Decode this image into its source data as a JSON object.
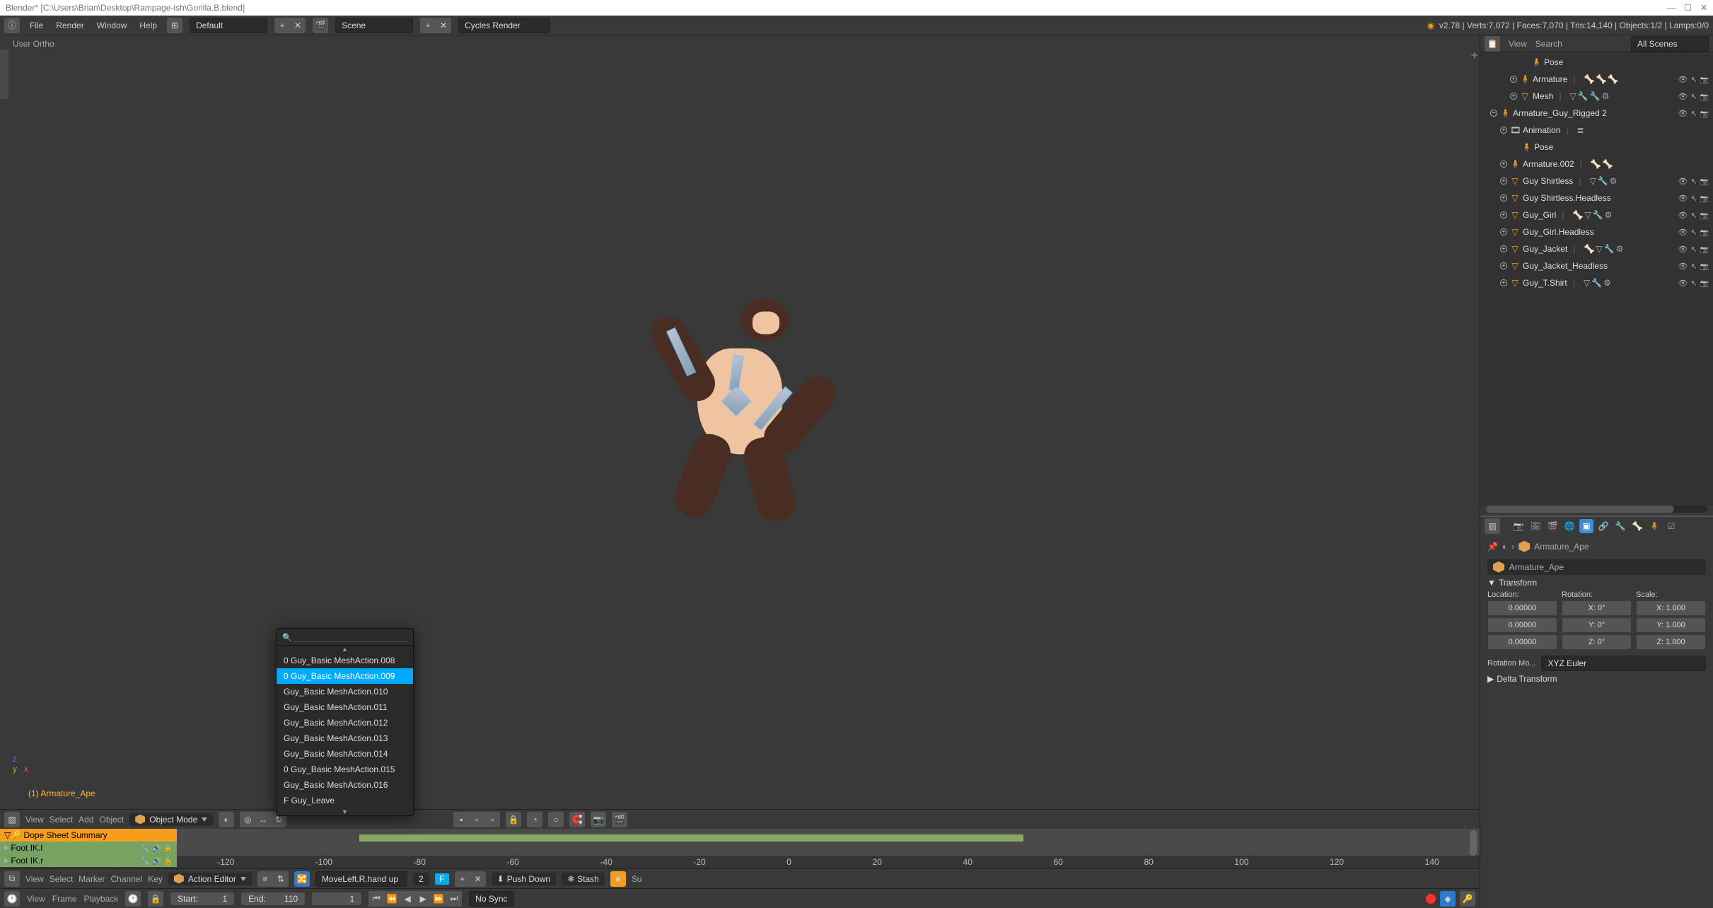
{
  "titlebar": {
    "title": "Blender* [C:\\Users\\Brian\\Desktop\\Rampage-ish\\Gorilla.B.blend]"
  },
  "top_menu": {
    "file": "File",
    "render": "Render",
    "window": "Window",
    "help": "Help",
    "layout_field": "Default",
    "scene_field": "Scene",
    "engine": "Cycles Render",
    "stats": "v2.78 | Verts:7,072 | Faces:7,070 | Tris:14,140 | Objects:1/2 | Lamps:0/0"
  },
  "view3d": {
    "overlay": "User Ortho",
    "selected": "(1) Armature_Ape",
    "axes": {
      "x": "x",
      "y": "y",
      "z": "z"
    }
  },
  "view3d_header": {
    "view": "View",
    "select": "Select",
    "add": "Add",
    "object": "Object",
    "mode": "Object Mode"
  },
  "action_popup": {
    "items": [
      {
        "label": "0 Guy_Basic MeshAction.008",
        "selected": false
      },
      {
        "label": "0 Guy_Basic MeshAction.009",
        "selected": true
      },
      {
        "label": "Guy_Basic MeshAction.010",
        "selected": false
      },
      {
        "label": "Guy_Basic MeshAction.011",
        "selected": false
      },
      {
        "label": "Guy_Basic MeshAction.012",
        "selected": false
      },
      {
        "label": "Guy_Basic MeshAction.013",
        "selected": false
      },
      {
        "label": "Guy_Basic MeshAction.014",
        "selected": false
      },
      {
        "label": "0 Guy_Basic MeshAction.015",
        "selected": false
      },
      {
        "label": "Guy_Basic MeshAction.016",
        "selected": false
      },
      {
        "label": "F Guy_Leave",
        "selected": false
      }
    ]
  },
  "outliner": {
    "view": "View",
    "search": "Search",
    "filter": "All Scenes",
    "rows": [
      {
        "indent": 4,
        "expand": "",
        "icon": "person",
        "name": "Pose",
        "icons": [],
        "vis": false
      },
      {
        "indent": 3,
        "expand": "plus",
        "icon": "person",
        "name": "Armature",
        "icons": [
          "bone",
          "bone",
          "bone"
        ],
        "vis": true
      },
      {
        "indent": 3,
        "expand": "plus",
        "icon": "tri",
        "name": "Mesh",
        "icons": [
          "tri",
          "wrench",
          "wrench",
          "gear"
        ],
        "vis": true
      },
      {
        "indent": 1,
        "expand": "minus",
        "icon": "person",
        "name": "Armature_Guy_Rigged 2",
        "icons": [],
        "vis": true
      },
      {
        "indent": 2,
        "expand": "plus",
        "icon": "anim",
        "name": "Animation",
        "icons": [
          "track"
        ],
        "vis": false
      },
      {
        "indent": 3,
        "expand": "",
        "icon": "person",
        "name": "Pose",
        "icons": [],
        "vis": false
      },
      {
        "indent": 2,
        "expand": "plus",
        "icon": "person",
        "name": "Armature.002",
        "icons": [
          "bone",
          "bone"
        ],
        "vis": false
      },
      {
        "indent": 2,
        "expand": "plus",
        "icon": "tri",
        "name": "Guy Shirtless",
        "icons": [
          "tri",
          "wrench",
          "gear"
        ],
        "vis": true
      },
      {
        "indent": 2,
        "expand": "plus",
        "icon": "tri",
        "name": "Guy Shirtless.Headless",
        "icons": [],
        "vis": true
      },
      {
        "indent": 2,
        "expand": "plus",
        "icon": "tri",
        "name": "Guy_Girl",
        "icons": [
          "bone",
          "tri",
          "wrench",
          "gear"
        ],
        "vis": true
      },
      {
        "indent": 2,
        "expand": "plus",
        "icon": "tri",
        "name": "Guy_Girl.Headless",
        "icons": [],
        "vis": true
      },
      {
        "indent": 2,
        "expand": "plus",
        "icon": "tri",
        "name": "Guy_Jacket",
        "icons": [
          "bone",
          "tri",
          "wrench",
          "gear"
        ],
        "vis": true
      },
      {
        "indent": 2,
        "expand": "plus",
        "icon": "tri",
        "name": "Guy_Jacket_Headless",
        "icons": [],
        "vis": true
      },
      {
        "indent": 2,
        "expand": "plus",
        "icon": "tri",
        "name": "Guy_T.Shirt",
        "icons": [
          "tri",
          "wrench",
          "gear"
        ],
        "vis": true
      }
    ]
  },
  "properties": {
    "breadcrumb": "Armature_Ape",
    "name_field": "Armature_Ape",
    "transform_label": "Transform",
    "location_label": "Location:",
    "rotation_label": "Rotation:",
    "scale_label": "Scale:",
    "loc": [
      "0.00000",
      "0.00000",
      "0.00000"
    ],
    "rot": [
      "X:      0°",
      "Y:      0°",
      "Z:      0°"
    ],
    "scl": [
      "X: 1.000",
      "Y: 1.000",
      "Z: 1.000"
    ],
    "rot_mode_label": "Rotation Mo...",
    "rot_mode": "XYZ Euler",
    "delta_label": "Delta Transform"
  },
  "dope_summary": {
    "title": "Dope Sheet Summary",
    "rows": [
      "Foot IK.l",
      "Foot IK.r"
    ],
    "ruler": [
      "-120",
      "-100",
      "-80",
      "-60",
      "-40",
      "-20",
      "0",
      "20",
      "40",
      "60",
      "80",
      "100",
      "120",
      "140"
    ]
  },
  "dope_header": {
    "view": "View",
    "select": "Select",
    "marker": "Marker",
    "channel": "Channel",
    "key": "Key",
    "editor": "Action Editor",
    "action_name": "MoveLeft.R.hand up",
    "users": "2",
    "f": "F",
    "push_down": "Push Down",
    "stash": "Stash",
    "summary_toggle": "Su"
  },
  "timeline": {
    "view": "View",
    "frame": "Frame",
    "playback": "Playback",
    "start_label": "Start:",
    "start": "1",
    "end_label": "End:",
    "end": "110",
    "current": "1",
    "sync": "No Sync"
  }
}
